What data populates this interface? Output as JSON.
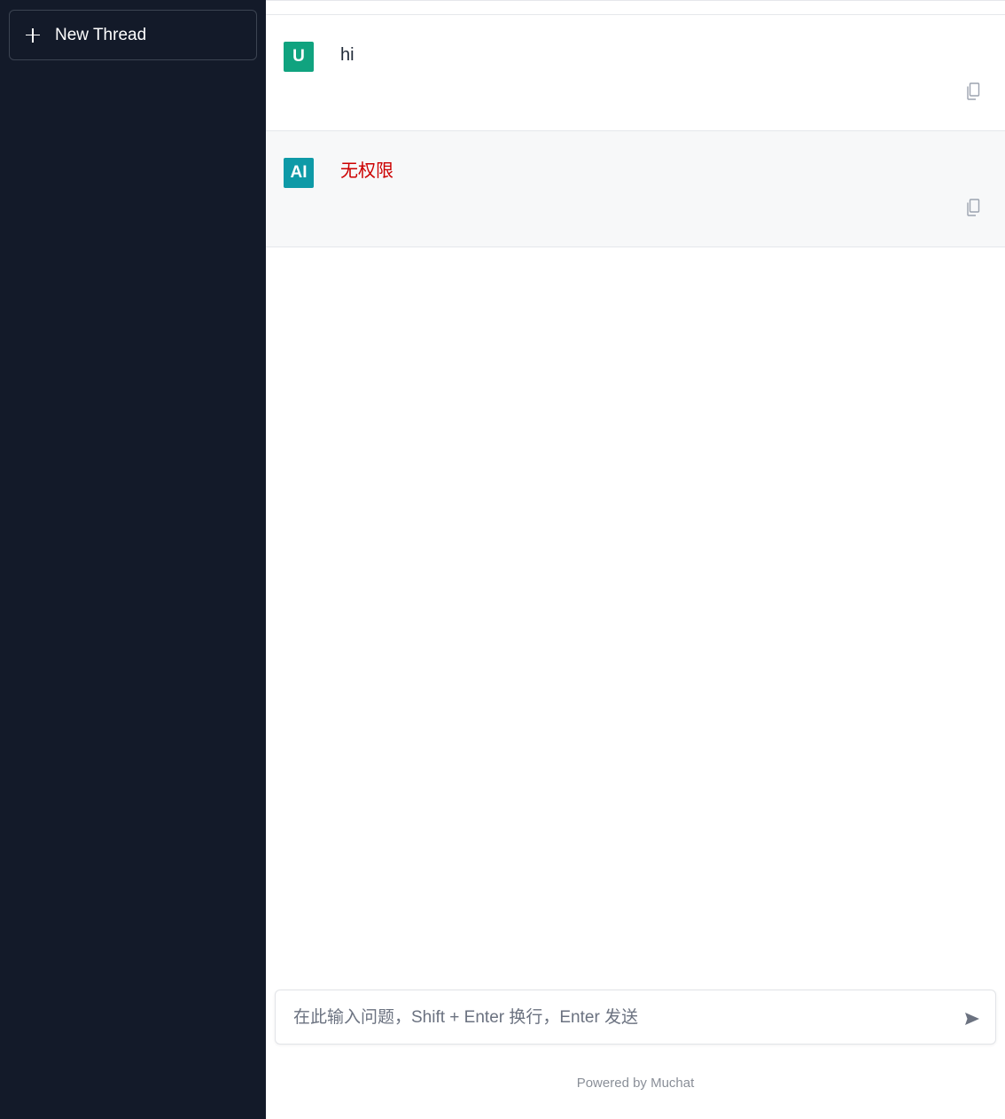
{
  "sidebar": {
    "new_thread_label": "New Thread"
  },
  "messages": [
    {
      "role": "user",
      "avatar_label": "U",
      "avatar_color": "#10a37f",
      "text": "hi"
    },
    {
      "role": "ai",
      "avatar_label": "AI",
      "avatar_color": "#0e9aa7",
      "text": "无权限",
      "text_color": "#cc0000"
    }
  ],
  "composer": {
    "placeholder": "在此输入问题，Shift + Enter 换行，Enter 发送"
  },
  "footer": {
    "text": "Powered by Muchat"
  },
  "icons": {
    "new_thread": "plus-icon",
    "copy": "copy-icon",
    "send": "send-icon"
  }
}
